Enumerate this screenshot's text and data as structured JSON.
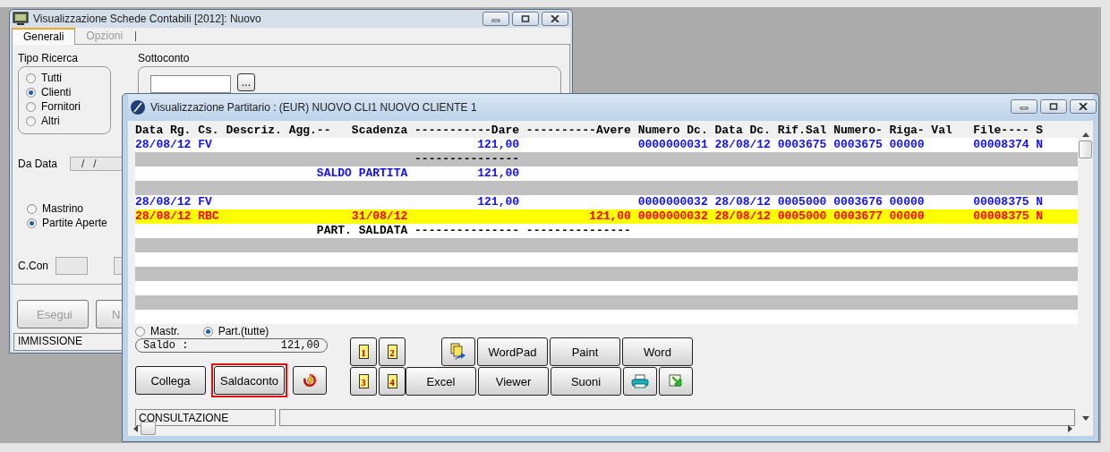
{
  "back_window": {
    "title": "Visualizzazione Schede Contabili [2012]: Nuovo",
    "tabs": [
      {
        "label": "Generali",
        "selected": true
      },
      {
        "label": "Opzioni",
        "selected": false
      }
    ],
    "tipo_ricerca": {
      "label": "Tipo Ricerca",
      "options": [
        {
          "label": "Tutti",
          "selected": false
        },
        {
          "label": "Clienti",
          "selected": true
        },
        {
          "label": "Fornitori",
          "selected": false
        },
        {
          "label": "Altri",
          "selected": false
        }
      ]
    },
    "sottoconto": {
      "label": "Sottoconto",
      "button": "..."
    },
    "da_data": {
      "label": "Da Data",
      "value": "/   /"
    },
    "modo": [
      {
        "label": "Mastrino",
        "selected": false
      },
      {
        "label": "Partite Aperte",
        "selected": true
      }
    ],
    "c_con": {
      "label": "C.Con"
    },
    "buttons": [
      {
        "label": "Esegui",
        "disabled": true
      },
      {
        "label": "N",
        "disabled": true
      }
    ],
    "status": "IMMISSIONE"
  },
  "front_window": {
    "title": "Visualizzazione Partitario :  (EUR) NUOVO CLI1 NUOVO CLIENTE 1",
    "grid": {
      "header": "Data Rg. Cs. Descriz. Agg.--   Scadenza -----------Dare ----------Avere Numero Dc. Data Dc. Rif.Sal Numero- Riga- Val   File---- S",
      "rows": [
        {
          "kind": "entry",
          "selected": false,
          "text": "28/08/12 FV                                      121,00                 0000000031 28/08/12 0003675 0003675 00000       00008374 N"
        },
        {
          "kind": "separator",
          "selected": false,
          "text": "                                        ---------------"
        },
        {
          "kind": "total",
          "selected": false,
          "text": "                          SALDO PARTITA          121,00"
        },
        {
          "kind": "blank"
        },
        {
          "kind": "entry",
          "selected": false,
          "text": "28/08/12 FV                                      121,00                 0000000032 28/08/12 0005000 0003676 00000       00008375 N"
        },
        {
          "kind": "payment",
          "selected": true,
          "text": "28/08/12 RBC                   31/08/12                          121,00 0000000032 28/08/12 0005000 0003677 00000       00008375 N"
        },
        {
          "kind": "closed",
          "selected": false,
          "text": "                          PART. SALDATA --------------- ---------------"
        }
      ]
    },
    "view": [
      {
        "label": "Mastr.",
        "selected": false
      },
      {
        "label": "Part.(tutte)",
        "selected": true
      }
    ],
    "saldo": {
      "label": "Saldo :",
      "value": "121,00"
    },
    "actions": [
      {
        "kind": "text",
        "label": "Collega",
        "highlighted": false
      },
      {
        "kind": "text",
        "label": "Saldaconto",
        "highlighted": true
      },
      {
        "kind": "refresh",
        "highlighted": false
      }
    ],
    "tool_rows": [
      {
        "pages": [
          "1",
          "2"
        ],
        "buttons": [
          {
            "kind": "copy"
          },
          {
            "kind": "text",
            "label": "WordPad"
          },
          {
            "kind": "text",
            "label": "Paint"
          },
          {
            "kind": "text",
            "label": "Word"
          }
        ]
      },
      {
        "pages": [
          "3",
          "4"
        ],
        "buttons": [
          {
            "kind": "text",
            "label": "Excel"
          },
          {
            "kind": "text",
            "label": "Viewer"
          },
          {
            "kind": "text",
            "label": "Suoni"
          },
          {
            "kind": "print"
          },
          {
            "kind": "export"
          }
        ]
      }
    ],
    "status": "CONSULTAZIONE"
  }
}
